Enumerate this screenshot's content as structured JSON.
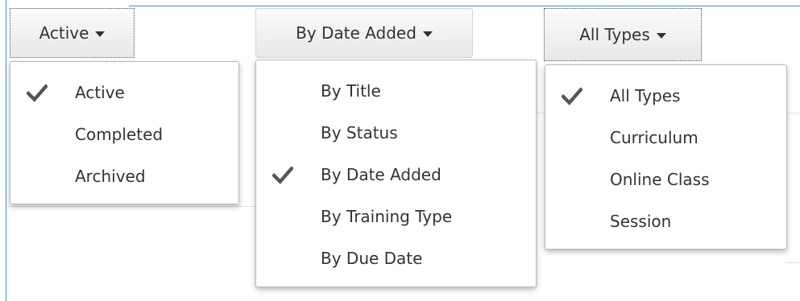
{
  "filters": {
    "status": {
      "button_label": "Active",
      "options": [
        {
          "label": "Active",
          "checked": true
        },
        {
          "label": "Completed",
          "checked": false
        },
        {
          "label": "Archived",
          "checked": false
        }
      ]
    },
    "sort": {
      "button_label": "By Date Added",
      "options": [
        {
          "label": "By Title",
          "checked": false
        },
        {
          "label": "By Status",
          "checked": false
        },
        {
          "label": "By Date Added",
          "checked": true
        },
        {
          "label": "By Training Type",
          "checked": false
        },
        {
          "label": "By Due Date",
          "checked": false
        }
      ]
    },
    "type": {
      "button_label": "All Types",
      "options": [
        {
          "label": "All Types",
          "checked": true
        },
        {
          "label": "Curriculum",
          "checked": false
        },
        {
          "label": "Online Class",
          "checked": false
        },
        {
          "label": "Session",
          "checked": false
        }
      ]
    }
  },
  "icons": {
    "caret": "caret-down-icon",
    "check": "check-icon"
  },
  "colors": {
    "frame_border": "#3a8fd6",
    "text": "#333333",
    "check": "#555555"
  }
}
